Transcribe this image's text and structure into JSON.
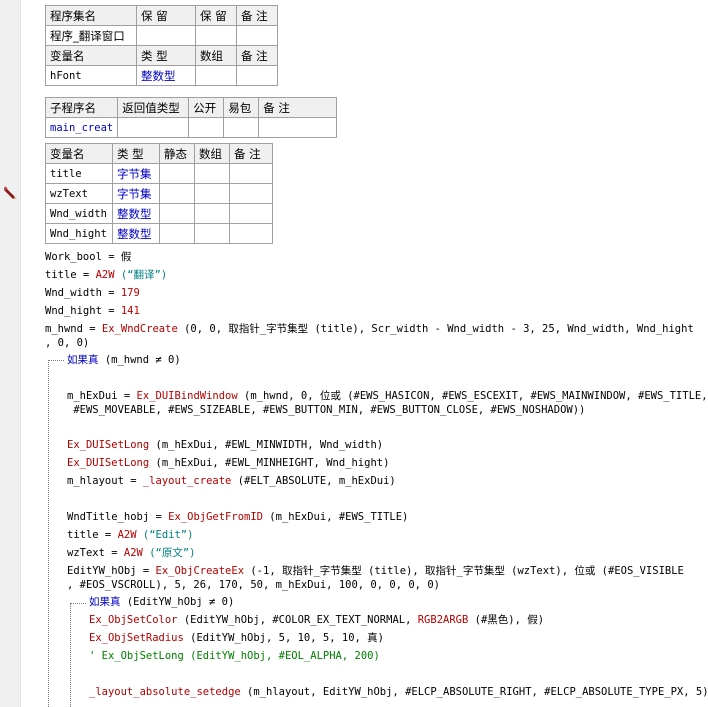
{
  "program_set_table": {
    "headers": [
      "程序集名",
      "保 留",
      "保 留",
      "备 注"
    ],
    "name": "程序_翻译窗口"
  },
  "program_var_table": {
    "headers": [
      "变量名",
      "类 型",
      "数组",
      "备 注"
    ],
    "rows": [
      {
        "name": "hFont",
        "type": "整数型"
      }
    ]
  },
  "sub_table": {
    "headers": [
      "子程序名",
      "返回值类型",
      "公开",
      "易包",
      "备 注"
    ],
    "name": "main_creat"
  },
  "local_var_table": {
    "headers": [
      "变量名",
      "类 型",
      "静态",
      "数组",
      "备 注"
    ],
    "rows": [
      {
        "name": "title",
        "type": "字节集"
      },
      {
        "name": "wzText",
        "type": "字节集"
      },
      {
        "name": "Wnd_width",
        "type": "整数型"
      },
      {
        "name": "Wnd_hight",
        "type": "整数型"
      }
    ]
  },
  "code": {
    "l1": {
      "a": "Work_bool = 假"
    },
    "l2": {
      "a": "title = ",
      "b": "A2W",
      "c": " (“翻译”)"
    },
    "l3": {
      "a": "Wnd_width = ",
      "b": "179"
    },
    "l4": {
      "a": "Wnd_hight = ",
      "b": "141"
    },
    "l5": {
      "a": "m_hwnd = ",
      "b": "Ex_WndCreate",
      "c": " (0, 0, 取指针_字节集型 (title), Scr_width - Wnd_width - 3, 25, Wnd_width, Wnd_hight"
    },
    "l5b": {
      "a": ", 0, 0)"
    },
    "l6": {
      "a": "如果真",
      "b": " (m_hwnd ≠ 0)"
    },
    "l7": {
      "a": "m_hExDui = ",
      "b": "Ex_DUIBindWindow",
      "c": " (m_hwnd, 0, 位或 (#EWS_HASICON, #EWS_ESCEXIT, #EWS_MAINWINDOW, #EWS_TITLE,"
    },
    "l7b": {
      "a": " #EWS_MOVEABLE, #EWS_SIZEABLE, #EWS_BUTTON_MIN, #EWS_BUTTON_CLOSE, #EWS_NOSHADOW))"
    },
    "l8": {
      "a": "Ex_DUISetLong",
      "b": " (m_hExDui, #EWL_MINWIDTH, Wnd_width)"
    },
    "l9": {
      "a": "Ex_DUISetLong",
      "b": " (m_hExDui, #EWL_MINHEIGHT, Wnd_hight)"
    },
    "l10": {
      "a": "m_hlayout = ",
      "b": "_layout_create",
      "c": " (#ELT_ABSOLUTE, m_hExDui)"
    },
    "l11": {
      "a": "WndTitle_hobj = ",
      "b": "Ex_ObjGetFromID",
      "c": " (m_hExDui, #EWS_TITLE)"
    },
    "l12": {
      "a": "title = ",
      "b": "A2W",
      "c": " (“Edit”)"
    },
    "l13": {
      "a": "wzText = ",
      "b": "A2W",
      "c": " (“原文”)"
    },
    "l14": {
      "a": "EditYW_hObj = ",
      "b": "Ex_ObjCreateEx",
      "c": " (-1, 取指针_字节集型 (title), 取指针_字节集型 (wzText), 位或 (#EOS_VISIBLE"
    },
    "l14b": {
      "a": ", #EOS_VSCROLL), 5, 26, 170, 50, m_hExDui, 100, 0, 0, 0, 0)"
    },
    "l15": {
      "a": "如果真",
      "b": " (EditYW_hObj ≠ 0)"
    },
    "l16": {
      "a": "Ex_ObjSetColor",
      "b": " (EditYW_hObj, #COLOR_EX_TEXT_NORMAL, ",
      "c": "RGB2ARGB",
      "d": " (#黑色), 假)"
    },
    "l17": {
      "a": "Ex_ObjSetRadius",
      "b": " (EditYW_hObj, 5, 10, 5, 10, 真)"
    },
    "l18": {
      "a": "' Ex_ObjSetLong (EditYW_hObj, #EOL_ALPHA, 200)"
    },
    "l19": {
      "a": "_layout_absolute_setedge",
      "b": " (m_hlayout, EditYW_hObj, #ELCP_ABSOLUTE_RIGHT, #ELCP_ABSOLUTE_TYPE_PX, 5)"
    }
  }
}
